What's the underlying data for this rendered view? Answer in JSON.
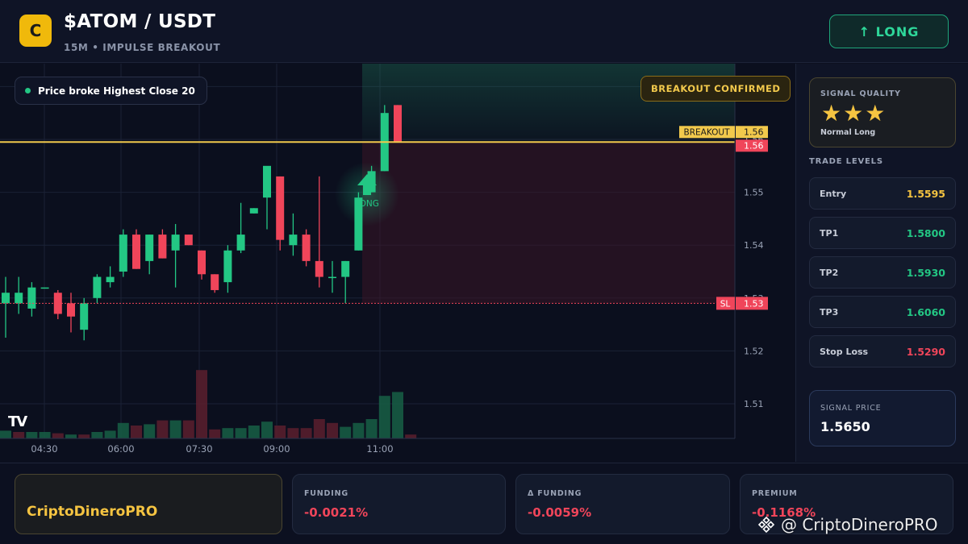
{
  "header": {
    "logo_letter": "C",
    "title": "$ATOM / USDT",
    "subtitle": "15M • IMPULSE BREAKOUT",
    "direction_button": "↑ LONG"
  },
  "chart": {
    "legend_text": "Price broke Highest Close 20",
    "badge_text": "BREAKOUT CONFIRMED",
    "logo_text": "TV",
    "breakout_label": "BREAKOUT",
    "breakout_value": "1.56",
    "current_value": "1.56",
    "sl_label": "SL",
    "sl_value": "1.53",
    "signal_text": "LONG",
    "colors": {
      "up": "#23c784",
      "down": "#f0455a",
      "breakout": "#f2c94c",
      "sl": "#f0455a"
    }
  },
  "chart_data": {
    "type": "candlestick",
    "y_ticks": [
      "1.51",
      "1.52",
      "1.53",
      "1.54",
      "1.55",
      "1.56",
      "1.57"
    ],
    "x_ticks": [
      "04:30",
      "06:00",
      "07:30",
      "09:00",
      "11:00"
    ],
    "breakout_level": 1.5595,
    "stop_loss_level": 1.529,
    "candles": [
      {
        "o": 1.529,
        "h": 1.534,
        "l": 1.5225,
        "c": 1.531
      },
      {
        "o": 1.529,
        "h": 1.534,
        "l": 1.527,
        "c": 1.531
      },
      {
        "o": 1.528,
        "h": 1.533,
        "l": 1.5265,
        "c": 1.532
      },
      {
        "o": 1.532,
        "h": 1.532,
        "l": 1.532,
        "c": 1.532
      },
      {
        "o": 1.531,
        "h": 1.5315,
        "l": 1.526,
        "c": 1.527
      },
      {
        "o": 1.529,
        "h": 1.531,
        "l": 1.5235,
        "c": 1.5265
      },
      {
        "o": 1.524,
        "h": 1.53,
        "l": 1.522,
        "c": 1.529
      },
      {
        "o": 1.53,
        "h": 1.5345,
        "l": 1.529,
        "c": 1.534
      },
      {
        "o": 1.533,
        "h": 1.536,
        "l": 1.532,
        "c": 1.534
      },
      {
        "o": 1.535,
        "h": 1.543,
        "l": 1.534,
        "c": 1.542
      },
      {
        "o": 1.542,
        "h": 1.543,
        "l": 1.5355,
        "c": 1.5355
      },
      {
        "o": 1.537,
        "h": 1.542,
        "l": 1.5345,
        "c": 1.542
      },
      {
        "o": 1.542,
        "h": 1.543,
        "l": 1.5375,
        "c": 1.5375
      },
      {
        "o": 1.539,
        "h": 1.544,
        "l": 1.532,
        "c": 1.542
      },
      {
        "o": 1.542,
        "h": 1.542,
        "l": 1.54,
        "c": 1.54
      },
      {
        "o": 1.539,
        "h": 1.539,
        "l": 1.5335,
        "c": 1.5345
      },
      {
        "o": 1.5345,
        "h": 1.5345,
        "l": 1.531,
        "c": 1.5315
      },
      {
        "o": 1.533,
        "h": 1.54,
        "l": 1.531,
        "c": 1.539
      },
      {
        "o": 1.539,
        "h": 1.548,
        "l": 1.5385,
        "c": 1.542
      },
      {
        "o": 1.546,
        "h": 1.547,
        "l": 1.546,
        "c": 1.547
      },
      {
        "o": 1.549,
        "h": 1.551,
        "l": 1.543,
        "c": 1.555
      },
      {
        "o": 1.553,
        "h": 1.553,
        "l": 1.539,
        "c": 1.541
      },
      {
        "o": 1.54,
        "h": 1.546,
        "l": 1.538,
        "c": 1.542
      },
      {
        "o": 1.542,
        "h": 1.543,
        "l": 1.536,
        "c": 1.537
      },
      {
        "o": 1.537,
        "h": 1.553,
        "l": 1.532,
        "c": 1.534
      },
      {
        "o": 1.534,
        "h": 1.537,
        "l": 1.531,
        "c": 1.534
      },
      {
        "o": 1.534,
        "h": 1.537,
        "l": 1.529,
        "c": 1.537
      },
      {
        "o": 1.539,
        "h": 1.55,
        "l": 1.539,
        "c": 1.549
      },
      {
        "o": 1.55,
        "h": 1.555,
        "l": 1.55,
        "c": 1.554
      },
      {
        "o": 1.554,
        "h": 1.5665,
        "l": 1.554,
        "c": 1.565
      },
      {
        "o": 1.5665,
        "h": 1.5665,
        "l": 1.5595,
        "c": 1.5595
      }
    ],
    "volumes": [
      0.06,
      0.05,
      0.05,
      0.05,
      0.04,
      0.03,
      0.03,
      0.05,
      0.06,
      0.12,
      0.1,
      0.11,
      0.14,
      0.14,
      0.14,
      0.53,
      0.07,
      0.08,
      0.08,
      0.1,
      0.13,
      0.1,
      0.08,
      0.08,
      0.15,
      0.12,
      0.09,
      0.12,
      0.15,
      0.33,
      0.36,
      0.03
    ],
    "volume_up": [
      true,
      false,
      true,
      true,
      false,
      true,
      false,
      true,
      true,
      true,
      false,
      true,
      false,
      true,
      false,
      false,
      false,
      true,
      true,
      true,
      true,
      false,
      false,
      false,
      false,
      false,
      true,
      true,
      true,
      true,
      true,
      false
    ]
  },
  "sidebar": {
    "quality_title": "SIGNAL QUALITY",
    "stars": "★★★",
    "quality_note": "Normal Long",
    "levels_title": "TRADE LEVELS",
    "levels": [
      {
        "name": "Entry",
        "value": "1.5595",
        "color": "#f5c441"
      },
      {
        "name": "TP1",
        "value": "1.5800",
        "color": "#23c784"
      },
      {
        "name": "TP2",
        "value": "1.5930",
        "color": "#23c784"
      },
      {
        "name": "TP3",
        "value": "1.6060",
        "color": "#23c784"
      },
      {
        "name": "Stop Loss",
        "value": "1.5290",
        "color": "#f0455a"
      }
    ],
    "signal_price_title": "SIGNAL PRICE",
    "signal_price_value": "1.5650"
  },
  "bottom": {
    "brand": "CriptoDineroPRO",
    "metrics": [
      {
        "label": "FUNDING",
        "value": "-0.0021%"
      },
      {
        "label": "Δ FUNDING",
        "value": "-0.0059%"
      },
      {
        "label": "PREMIUM",
        "value": "-0.1168%"
      }
    ],
    "watermark": "@ CriptoDineroPRO"
  }
}
